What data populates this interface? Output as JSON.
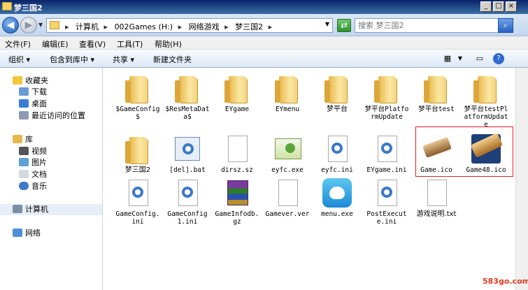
{
  "window": {
    "title": "梦三国2"
  },
  "controls": {
    "minimize": "_",
    "maximize": "□",
    "close": "×"
  },
  "address": {
    "crumbs": [
      "计算机",
      "002Games (H:)",
      "网络游戏",
      "梦三国2"
    ],
    "sep": "▸"
  },
  "search": {
    "placeholder": "搜索 梦三国2"
  },
  "menu": [
    "文件(F)",
    "编辑(E)",
    "查看(V)",
    "工具(T)",
    "帮助(H)"
  ],
  "toolbar": {
    "organize": "组织 ▾",
    "include": "包含到库中 ▾",
    "share": "共享 ▾",
    "new_folder": "新建文件夹"
  },
  "nav": {
    "favorites": "收藏夹",
    "downloads": "下载",
    "desktop": "桌面",
    "recent": "最近访问的位置",
    "libraries": "库",
    "videos": "视频",
    "pictures": "图片",
    "documents": "文档",
    "music": "音乐",
    "computer": "计算机",
    "network": "网络"
  },
  "files": {
    "f0": "$GameConfig$",
    "f1": "$ResMetaData$",
    "f2": "EYgame",
    "f3": "EYmenu",
    "f4": "梦平台",
    "f5": "梦平台PlatformUpdate",
    "f6": "梦平台test",
    "f7": "梦平台testPlatformUpdate",
    "f8": "梦三国2",
    "f9": "[del].bat",
    "f10": "dirsz.sz",
    "f11": "eyfc.exe",
    "f12": "eyfc.ini",
    "f13": "EYgame.ini",
    "f14": "Game.ico",
    "f15": "Game48.ico",
    "f16": "GameConfig.ini",
    "f17": "GameConfig1.ini",
    "f18": "GameInfodb.gz",
    "f19": "Gamever.ver",
    "f20": "menu.exe",
    "f21": "PostExecute.ini",
    "f22": "游戏说明.txt"
  },
  "watermark": "583go.com",
  "colors": {
    "highlight": "#e0202a",
    "title_bar": "#0a246a"
  }
}
